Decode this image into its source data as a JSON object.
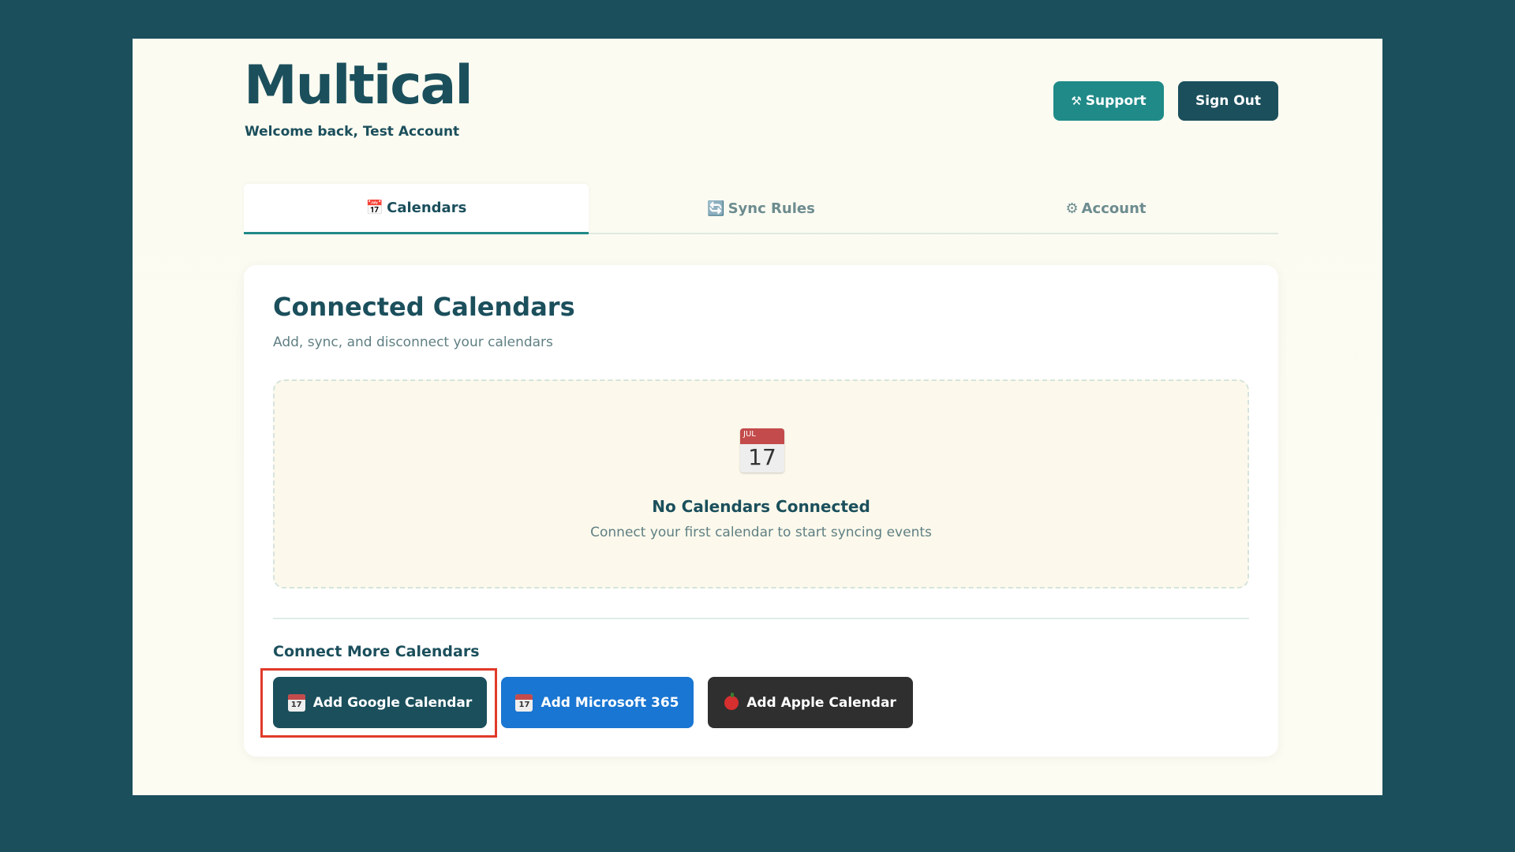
{
  "header": {
    "logo": "Multical",
    "welcome": "Welcome back, Test Account",
    "support_icon": "tools-icon",
    "support_label": "Support",
    "signout_label": "Sign Out"
  },
  "tabs": [
    {
      "label": "Calendars",
      "icon": "calendar-icon",
      "active": true
    },
    {
      "label": "Sync Rules",
      "icon": "sync-icon",
      "active": false
    },
    {
      "label": "Account",
      "icon": "gear-icon",
      "active": false
    }
  ],
  "main": {
    "title": "Connected Calendars",
    "subtitle": "Add, sync, and disconnect your calendars",
    "empty": {
      "icon_month": "JUL",
      "icon_day": "17",
      "title": "No Calendars Connected",
      "subtitle": "Connect your first calendar to start syncing events"
    },
    "connect_more_title": "Connect More Calendars",
    "buttons": {
      "google": "Add Google Calendar",
      "microsoft": "Add Microsoft 365",
      "apple": "Add Apple Calendar"
    }
  },
  "colors": {
    "background": "#1b4f5c",
    "primary": "#1b4f5c",
    "support": "#1f8a88",
    "microsoft": "#1976d2",
    "apple": "#2f2f2f",
    "highlight": "#e03a2a"
  }
}
